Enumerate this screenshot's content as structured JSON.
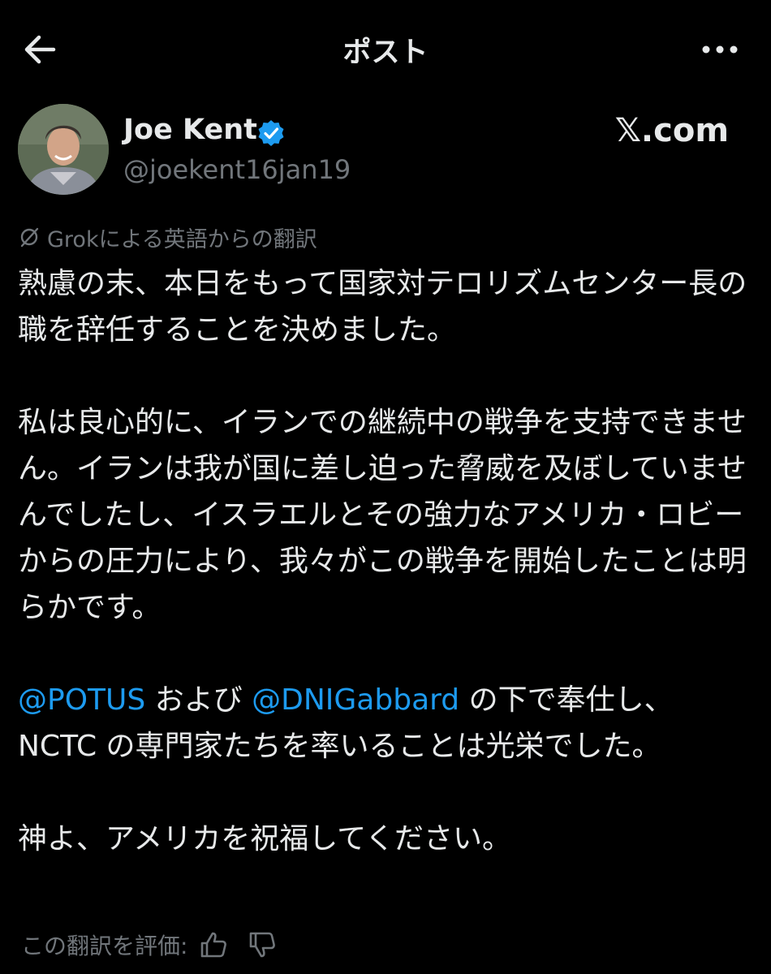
{
  "header": {
    "title": "ポスト",
    "back_icon": "arrow-left-icon",
    "more_icon": "more-horizontal-icon"
  },
  "author": {
    "name": "Joe Kent",
    "handle": "@joekent16jan19",
    "verified": true,
    "verified_color": "#1d9bf0",
    "site": "𝕏.com"
  },
  "translation": {
    "note": "Grokによる英語からの翻訳",
    "icon": "grok-icon"
  },
  "post": {
    "paragraph1": "熟慮の末、本日をもって国家対テロリズムセンター長の職を辞任することを決めました。",
    "paragraph2": "私は良心的に、イランでの継続中の戦争を支持できません。イランは我が国に差し迫った脅威を及ぼしていませんでしたし、イスラエルとその強力なアメリカ・ロビーからの圧力により、我々がこの戦争を開始したことは明らかです。",
    "paragraph3": {
      "mention1": "@POTUS",
      "text1": " および ",
      "mention2": "@DNIGabbard",
      "text2": " の下で奉仕し、NCTC の専門家たちを率いることは光栄でした。"
    },
    "paragraph4": "神よ、アメリカを祝福してください。"
  },
  "rating": {
    "label": "この翻訳を評価:",
    "up_icon": "thumbs-up-icon",
    "down_icon": "thumbs-down-icon"
  },
  "colors": {
    "background": "#000000",
    "text": "#e7e9ea",
    "secondary": "#71767b",
    "link": "#1d9bf0"
  }
}
